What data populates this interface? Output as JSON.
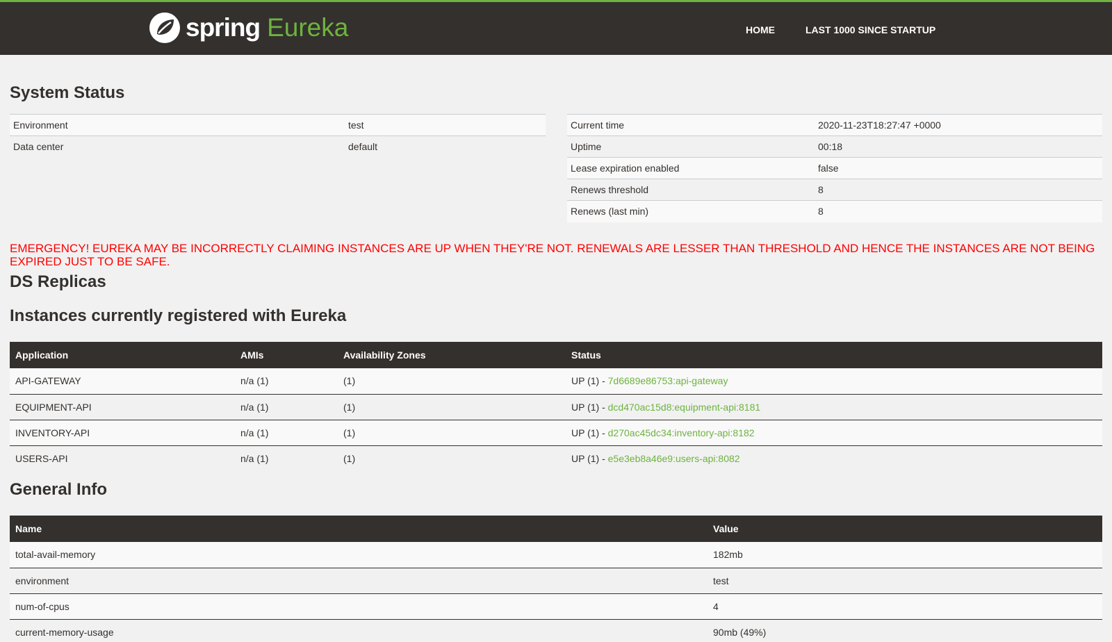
{
  "navbar": {
    "logo_spring": "spring",
    "logo_eureka": "Eureka",
    "home": "HOME",
    "last1000": "LAST 1000 SINCE STARTUP"
  },
  "colors": {
    "brand_green": "#6db33f",
    "navbar_bg": "#34302d",
    "emergency_red": "#ff0000"
  },
  "system_status": {
    "title": "System Status",
    "left": [
      {
        "label": "Environment",
        "value": "test"
      },
      {
        "label": "Data center",
        "value": "default"
      }
    ],
    "right": [
      {
        "label": "Current time",
        "value": "2020-11-23T18:27:47 +0000"
      },
      {
        "label": "Uptime",
        "value": "00:18"
      },
      {
        "label": "Lease expiration enabled",
        "value": "false"
      },
      {
        "label": "Renews threshold",
        "value": "8"
      },
      {
        "label": "Renews (last min)",
        "value": "8"
      }
    ]
  },
  "emergency": "EMERGENCY! EUREKA MAY BE INCORRECTLY CLAIMING INSTANCES ARE UP WHEN THEY'RE NOT. RENEWALS ARE LESSER THAN THRESHOLD AND HENCE THE INSTANCES ARE NOT BEING EXPIRED JUST TO BE SAFE.",
  "ds_replicas": {
    "title": "DS Replicas"
  },
  "instances": {
    "title": "Instances currently registered with Eureka",
    "columns": [
      "Application",
      "AMIs",
      "Availability Zones",
      "Status"
    ],
    "rows": [
      {
        "application": "API-GATEWAY",
        "amis": "n/a (1)",
        "zones": "(1)",
        "status": "UP (1) - ",
        "link": "7d6689e86753:api-gateway"
      },
      {
        "application": "EQUIPMENT-API",
        "amis": "n/a (1)",
        "zones": "(1)",
        "status": "UP (1) - ",
        "link": "dcd470ac15d8:equipment-api:8181"
      },
      {
        "application": "INVENTORY-API",
        "amis": "n/a (1)",
        "zones": "(1)",
        "status": "UP (1) - ",
        "link": "d270ac45dc34:inventory-api:8182"
      },
      {
        "application": "USERS-API",
        "amis": "n/a (1)",
        "zones": "(1)",
        "status": "UP (1) - ",
        "link": "e5e3eb8a46e9:users-api:8082"
      }
    ]
  },
  "general_info": {
    "title": "General Info",
    "columns": [
      "Name",
      "Value"
    ],
    "rows": [
      {
        "name": "total-avail-memory",
        "value": "182mb"
      },
      {
        "name": "environment",
        "value": "test"
      },
      {
        "name": "num-of-cpus",
        "value": "4"
      },
      {
        "name": "current-memory-usage",
        "value": "90mb (49%)"
      }
    ]
  }
}
